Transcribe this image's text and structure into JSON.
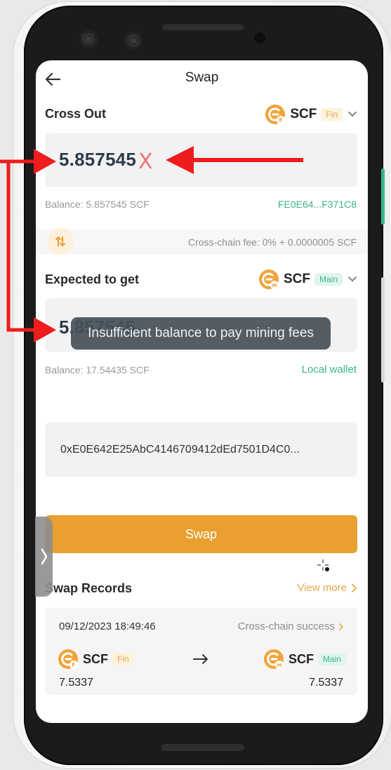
{
  "header": {
    "title": "Swap"
  },
  "cross_out": {
    "label": "Cross Out",
    "token": "SCF",
    "badge": "Fin",
    "amount": "5.857545",
    "balance": "Balance: 5.857545 SCF",
    "address_short": "FE0E64...F371C8"
  },
  "fee": {
    "text": "Cross-chain fee: 0% + 0.0000005 SCF"
  },
  "expected": {
    "label": "Expected to get",
    "token": "SCF",
    "badge": "Main",
    "amount": "5.857545",
    "balance": "Balance: 17.54435 SCF",
    "wallet": "Local wallet"
  },
  "toast": {
    "message": "Insufficient balance to pay mining fees"
  },
  "address": {
    "value": "0xE0E642E25AbC4146709412dEd7501D4C0..."
  },
  "swap_button": {
    "label": "Swap"
  },
  "records": {
    "title": "Swap Records",
    "view_more": "View more",
    "items": [
      {
        "time": "09/12/2023 18:49:46",
        "status": "Cross-chain success",
        "from_token": "SCF",
        "from_badge": "Fin",
        "to_token": "SCF",
        "to_badge": "Main",
        "from_amount": "7.5337",
        "to_amount": "7.5337"
      }
    ]
  },
  "annotation": {
    "mark": "X"
  },
  "colors": {
    "accent": "#e9a031",
    "green": "#3bb58a",
    "annotation_red": "#ee1c1c"
  },
  "icons": {
    "back": "arrow-left-icon",
    "swap_direction": "swap-vertical-icon",
    "dropdown": "chevron-down-icon",
    "record_arrow": "arrow-right-icon",
    "side_tab": "chevron-right-icon"
  }
}
